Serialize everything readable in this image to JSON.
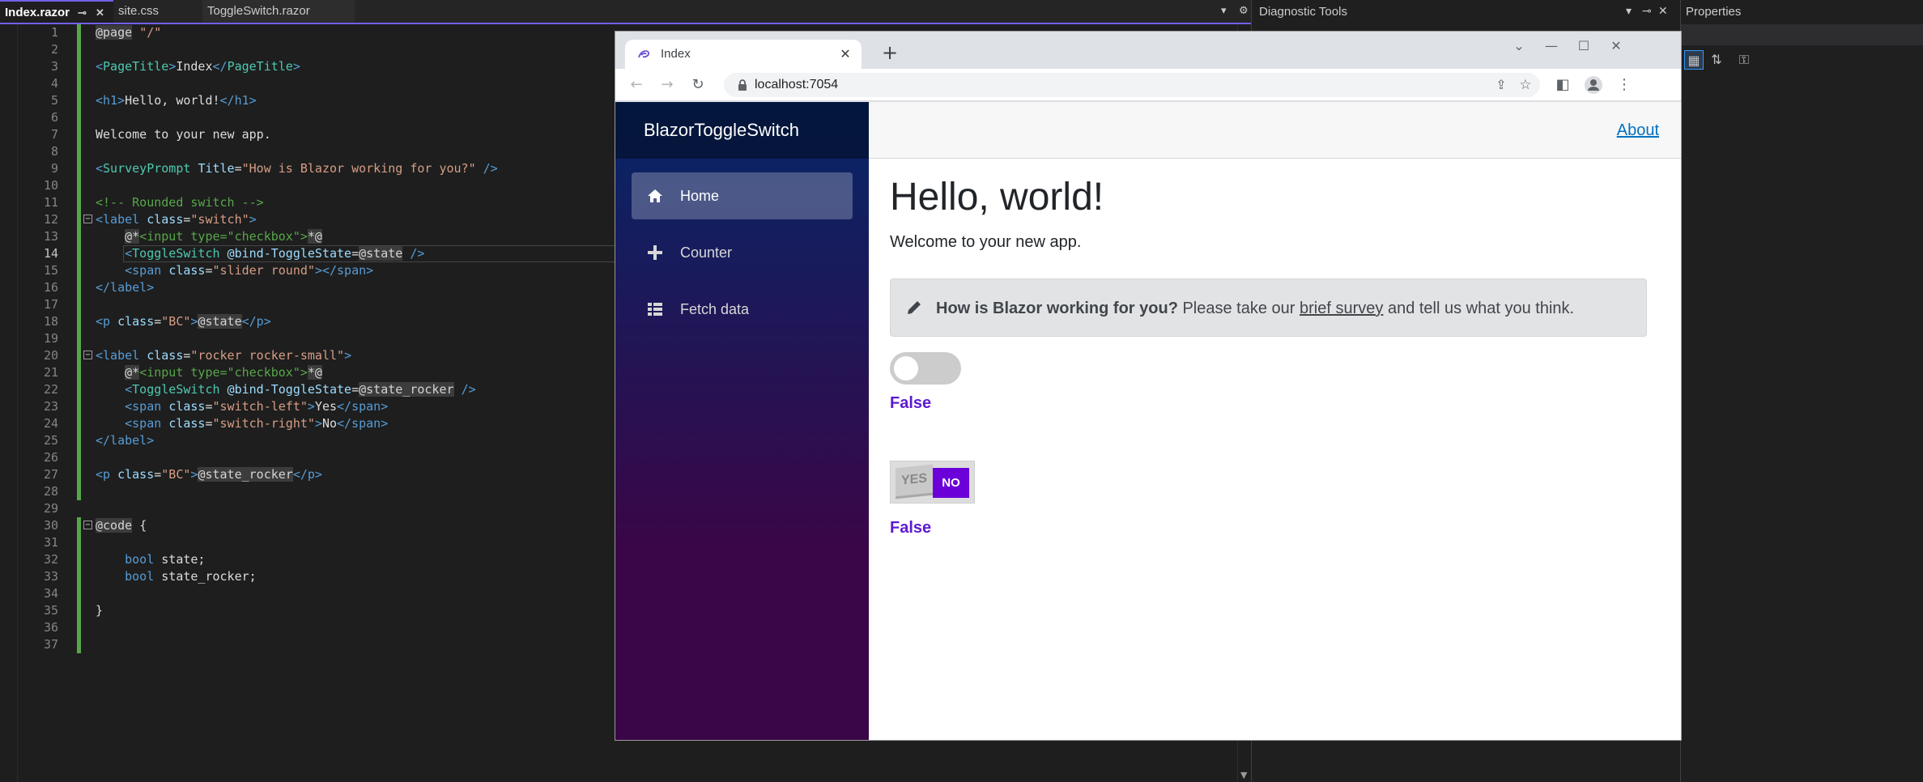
{
  "ide": {
    "tabs": [
      {
        "label": "Index.razor"
      },
      {
        "label": "site.css"
      },
      {
        "label": "ToggleSwitch.razor"
      }
    ],
    "diagnostic_title": "Diagnostic Tools",
    "properties_title": "Properties",
    "current_line": 14
  },
  "browser": {
    "tab_title": "Index",
    "url": "localhost:7054"
  },
  "app": {
    "brand": "BlazorToggleSwitch",
    "nav": [
      {
        "label": "Home",
        "icon": "home-icon"
      },
      {
        "label": "Counter",
        "icon": "plus-icon"
      },
      {
        "label": "Fetch data",
        "icon": "list-icon"
      }
    ],
    "about": "About",
    "heading": "Hello, world!",
    "welcome": "Welcome to your new app.",
    "survey": {
      "question": "How is Blazor working for you?",
      "prefix": "Please take our",
      "link": "brief survey",
      "suffix": "and tell us what you think."
    },
    "state_text": "False",
    "rocker": {
      "yes": "YES",
      "no": "NO"
    },
    "state_rocker_text": "False"
  },
  "colors": {
    "accent": "#7160e8",
    "bc_text": "#5e1ad1",
    "rocker_no": "#6b00d8",
    "link": "#0071c1"
  }
}
